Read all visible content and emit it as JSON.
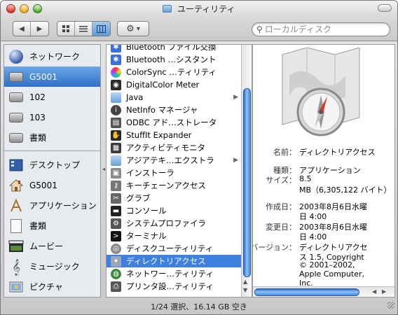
{
  "window": {
    "title": "ユーティリティ",
    "status": "1/24 選択、16.14 GB 空き"
  },
  "toolbar": {
    "back_glyph": "◀",
    "forward_glyph": "▶",
    "action_glyph": "⚙",
    "action_arrow": "▾",
    "search_placeholder": "ローカルディスク"
  },
  "sidebar": {
    "items": [
      {
        "label": "ネットワーク",
        "icon": "globe-icon"
      },
      {
        "label": "G5001",
        "icon": "hard-disk-icon",
        "selected": true
      },
      {
        "label": "102",
        "icon": "hard-disk-icon"
      },
      {
        "label": "103",
        "icon": "hard-disk-icon"
      },
      {
        "label": "書類",
        "icon": "hard-disk-icon"
      },
      {
        "label": "デスクトップ",
        "icon": "desktop-icon"
      },
      {
        "label": "G5001",
        "icon": "home-icon"
      },
      {
        "label": "アプリケーション",
        "icon": "applications-icon"
      },
      {
        "label": "書類",
        "icon": "documents-icon"
      },
      {
        "label": "ムービー",
        "icon": "movies-icon"
      },
      {
        "label": "ミュージック",
        "icon": "music-icon"
      },
      {
        "label": "ピクチャ",
        "icon": "pictures-icon"
      }
    ]
  },
  "files": [
    {
      "label": "Bluetooth ファイル交換",
      "color": "#3a6fd8"
    },
    {
      "label": "Bluetooth …シスタント",
      "color": "#3a6fd8"
    },
    {
      "label": "ColorSync …ティリティ",
      "color": "#d8563a"
    },
    {
      "label": "DigitalColor Meter",
      "color": "#2b2b2b"
    },
    {
      "label": "Java",
      "color": "#6a9ed6",
      "folder": true
    },
    {
      "label": "NetInfo マネージャ",
      "color": "#444444"
    },
    {
      "label": "ODBC アド…ストレータ",
      "color": "#555555"
    },
    {
      "label": "StuffIt Expander",
      "color": "#2a2a2a"
    },
    {
      "label": "アクティビティモニタ",
      "color": "#3b3b3b"
    },
    {
      "label": "アジアテキ…エクストラ",
      "color": "#6a9ed6",
      "folder": true
    },
    {
      "label": "インストーラ",
      "color": "#8a8a8a"
    },
    {
      "label": "キーチェーンアクセス",
      "color": "#777777"
    },
    {
      "label": "グラブ",
      "color": "#666666"
    },
    {
      "label": "コンソール",
      "color": "#1f1f1f"
    },
    {
      "label": "システムプロファイラ",
      "color": "#555555"
    },
    {
      "label": "ターミナル",
      "color": "#111111"
    },
    {
      "label": "ディスクユーティリティ",
      "color": "#8a8a8a"
    },
    {
      "label": "ディレクトリアクセス",
      "color": "#9aa7b8",
      "selected": true
    },
    {
      "label": "ネットワー…ティリティ",
      "color": "#3a8a3a"
    },
    {
      "label": "プリンタ設…ティリティ",
      "color": "#555555"
    }
  ],
  "preview": {
    "name_label": "名前：",
    "name_value": "ディレクトリアクセス",
    "kind_label": "種類：",
    "kind_value": "アプリケーション",
    "size_label": "サイズ：",
    "size_value_1": "8.5",
    "size_value_2": "MB（6,305,122 バイト）",
    "created_label": "作成日：",
    "created_value_1": "2003年8月6日水曜",
    "created_value_2": "日 4:00",
    "modified_label": "変更日：",
    "modified_value_1": "2003年8月6日水曜",
    "modified_value_2": "日 4:00",
    "version_label": "バージョン：",
    "version_value_1": "ディレクトリアクセ",
    "version_value_2": "ス 1.5, Copyright",
    "version_value_3": "© 2001–2002,",
    "version_value_4": "Apple Computer,",
    "version_value_5": "Inc."
  }
}
